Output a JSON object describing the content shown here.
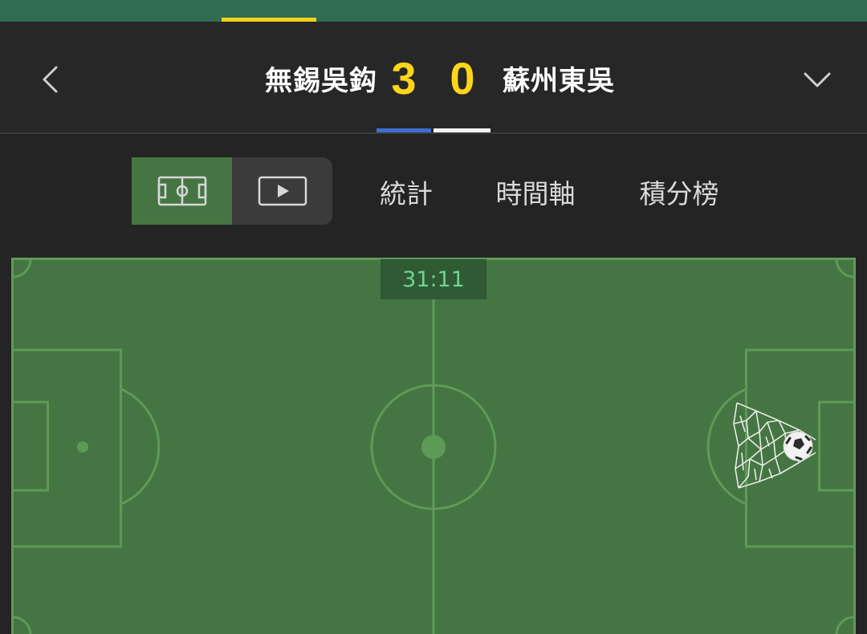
{
  "header": {
    "home_team": "無錫吳鈎",
    "away_team": "蘇州東吳",
    "home_score": "3",
    "away_score": "0",
    "home_color": "#3c6fd1",
    "away_color": "#f2f2f2",
    "back_icon": "chevron-left-icon",
    "expand_icon": "chevron-down-icon"
  },
  "view_switch": {
    "options": [
      {
        "name": "pitch-view",
        "icon": "pitch-icon",
        "selected": true
      },
      {
        "name": "video-view",
        "icon": "play-icon",
        "selected": false
      }
    ]
  },
  "tabs": [
    {
      "label": "統計"
    },
    {
      "label": "時間軸"
    },
    {
      "label": "積分榜"
    }
  ],
  "pitch": {
    "match_time": "31:11",
    "event": "goal",
    "event_icon": "goal-net-ball-icon",
    "pitch_color": "#457543",
    "line_color": "#5e9a57"
  },
  "colors": {
    "accent_yellow": "#ffd51a",
    "top_bar": "#2f6c52",
    "clock_text": "#6fd58c"
  }
}
